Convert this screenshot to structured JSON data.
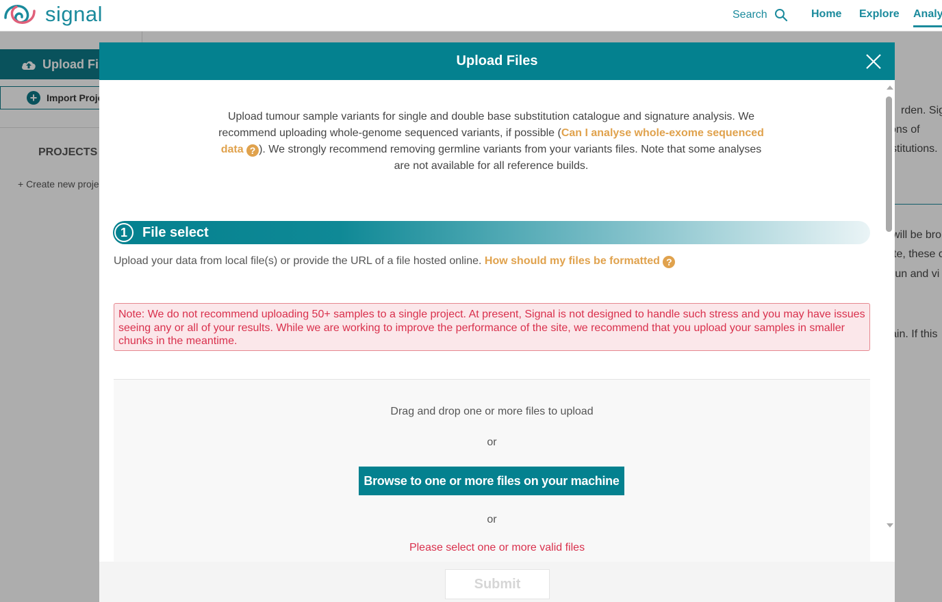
{
  "header": {
    "logo_text": "signal",
    "search_label": "Search",
    "nav": [
      "Home",
      "Explore",
      "Analysis"
    ]
  },
  "sidebar": {
    "upload_label": "Upload Files",
    "import_label": "Import Project",
    "projects_title": "PROJECTS",
    "create_project": "+ Create new project"
  },
  "background_text": {
    "line1": "rden. Sign",
    "line2": "ons of",
    "line3": "stitutions.",
    "line4": "will be bro",
    "line5": "te, these c",
    "line6": "run and vi",
    "line7": "ain. If this"
  },
  "modal": {
    "title": "Upload Files",
    "intro_part1": "Upload tumour sample variants for single and double base substitution catalogue and signature analysis. We recommend uploading whole-genome sequenced variants, if possible (",
    "intro_link": "Can I analyse whole-exome sequenced data",
    "intro_part2": "). We strongly recommend removing germline variants from your variants files. Note that some analyses are not available for all reference builds.",
    "step_number": "1",
    "step_title": "File select",
    "file_desc": "Upload your data from local file(s) or provide the URL of a file hosted online.",
    "format_link": "How should my files be formatted",
    "note": "Note: We do not recommend uploading 50+ samples to a single project. At present, Signal is not designed to handle such stress and you may have issues seeing any or all of your results. While we are working to improve the performance of the site, we recommend that you upload your samples in smaller chunks in the meantime.",
    "dropzone_text": "Drag and drop one or more files to upload",
    "or_1": "or",
    "browse_label": "Browse to one or more files on your machine",
    "or_2": "or",
    "error": "Please select one or more valid files",
    "submit_label": "Submit",
    "help_icon_glyph": "?"
  },
  "colors": {
    "brand": "#04818f",
    "link": "#e0a24d",
    "error": "#d9304c"
  }
}
